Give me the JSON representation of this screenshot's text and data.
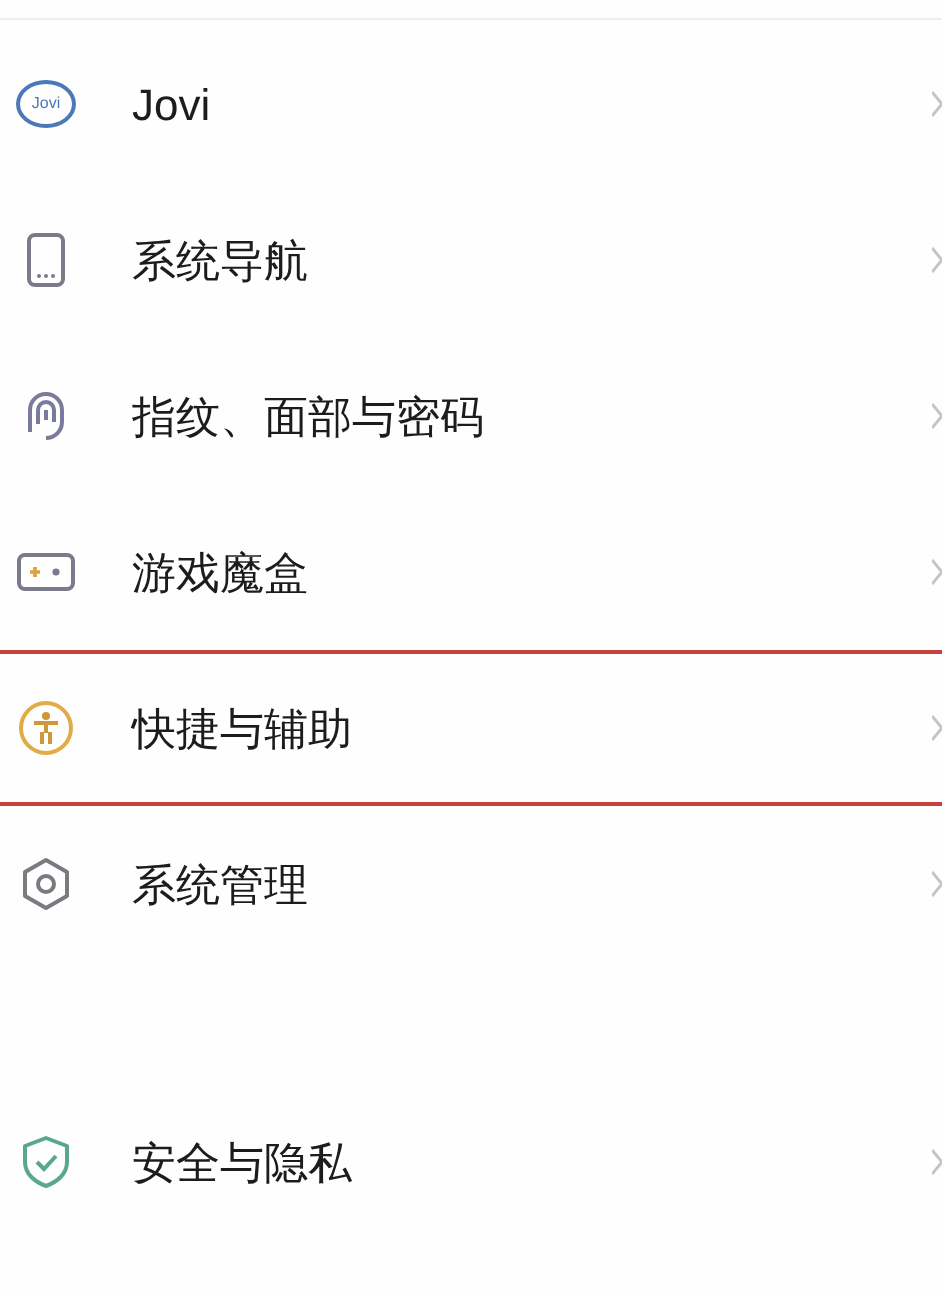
{
  "sections": [
    {
      "items": [
        {
          "kind": "jovi",
          "logo_text": "Jovi",
          "label": "Jovi",
          "highlighted": false
        },
        {
          "kind": "phone",
          "label": "系统导航",
          "highlighted": false
        },
        {
          "kind": "fingerprint",
          "label": "指纹、面部与密码",
          "highlighted": false
        },
        {
          "kind": "gamepad",
          "label": "游戏魔盒",
          "highlighted": false
        },
        {
          "kind": "accessibility",
          "label": "快捷与辅助",
          "highlighted": true
        },
        {
          "kind": "hexagon",
          "label": "系统管理",
          "highlighted": false
        }
      ]
    },
    {
      "items": [
        {
          "kind": "shield",
          "label": "安全与隐私",
          "highlighted": false
        }
      ]
    }
  ]
}
